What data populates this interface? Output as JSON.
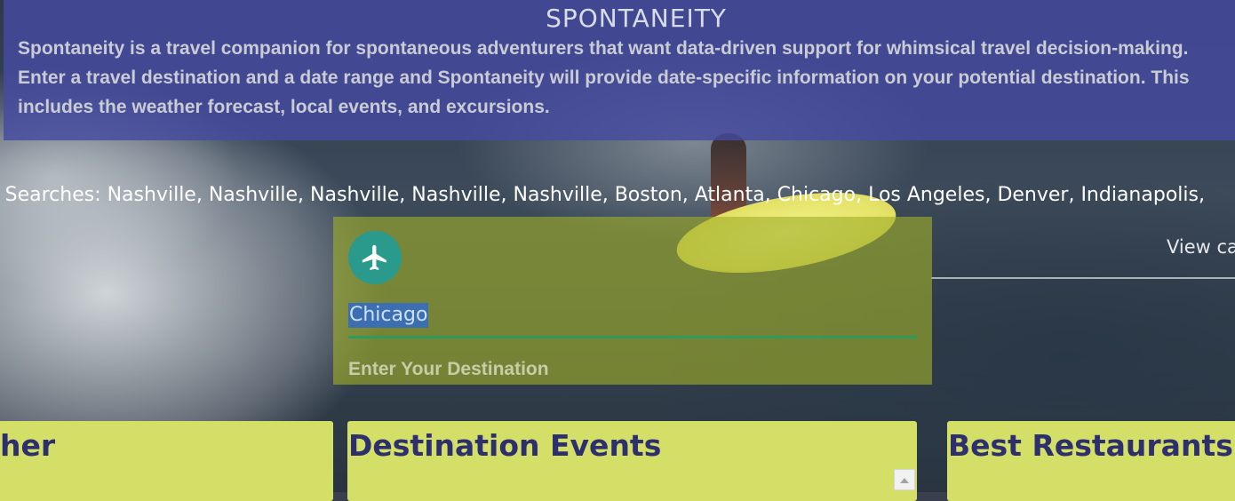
{
  "header": {
    "title": "SPONTANEITY",
    "description": "Spontaneity is a travel companion for spontaneous adventurers that want data-driven support for whimsical travel decision-making. Enter a travel destination and a date range and Spontaneity will provide date-specific information on your potential destination. This includes the weather forecast, local events, and excursions."
  },
  "recent": {
    "text": "t Searches: Nashville, Nashville, Nashville, Nashville, Nashville, Boston, Atlanta, Chicago, Los Angeles, Denver, Indianapolis,"
  },
  "search": {
    "value": "Chicago",
    "label": "Enter Your Destination",
    "icon": "airplane-icon"
  },
  "side_link": "View ca",
  "cards": {
    "weather_title": "her",
    "events_title": "Destination Events",
    "restaurants_title": "Best Restaurants"
  },
  "colors": {
    "header_bg": "#464BA0",
    "panel_bg": "#A0AF28",
    "card_bg": "#D3DF66",
    "card_title": "#2D2F6E",
    "input_underline": "#2E9A5C",
    "plane_button": "#2A9A8C",
    "selection": "#3B6FB2"
  }
}
